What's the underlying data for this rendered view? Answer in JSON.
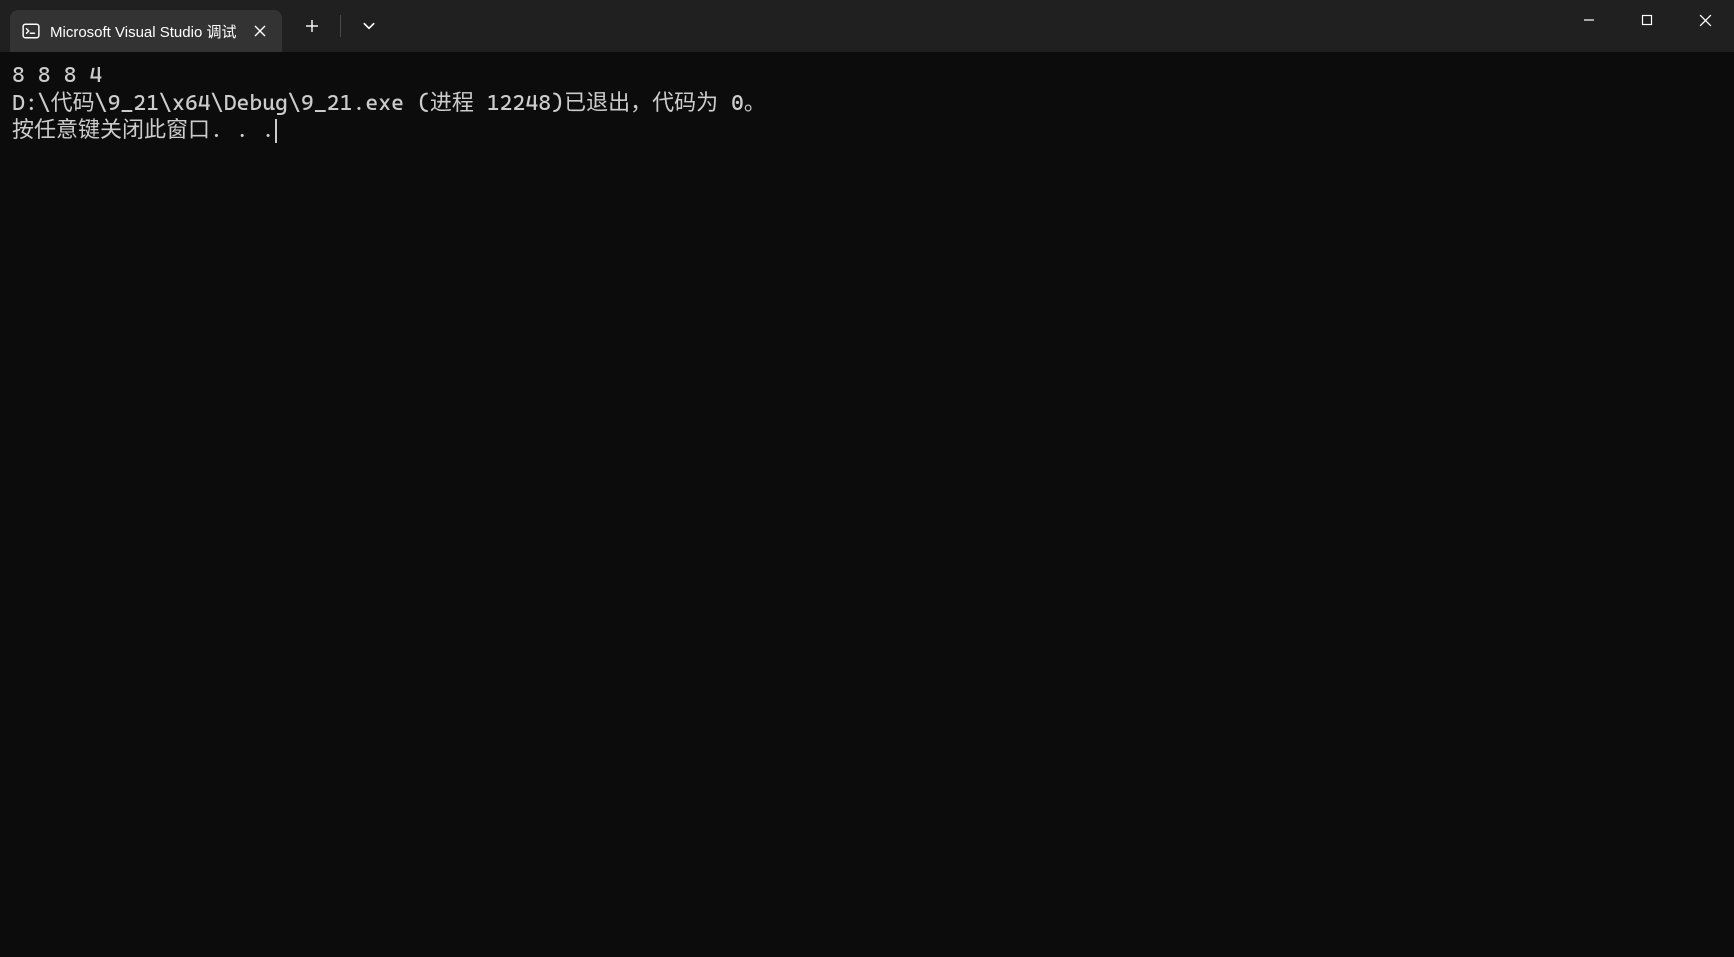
{
  "tab": {
    "title": "Microsoft Visual Studio 调试"
  },
  "terminal": {
    "line1": "8 8 8 4",
    "line2": "D:\\代码\\9_21\\x64\\Debug\\9_21.exe (进程 12248)已退出，代码为 0。",
    "line3": "按任意键关闭此窗口. . ."
  }
}
